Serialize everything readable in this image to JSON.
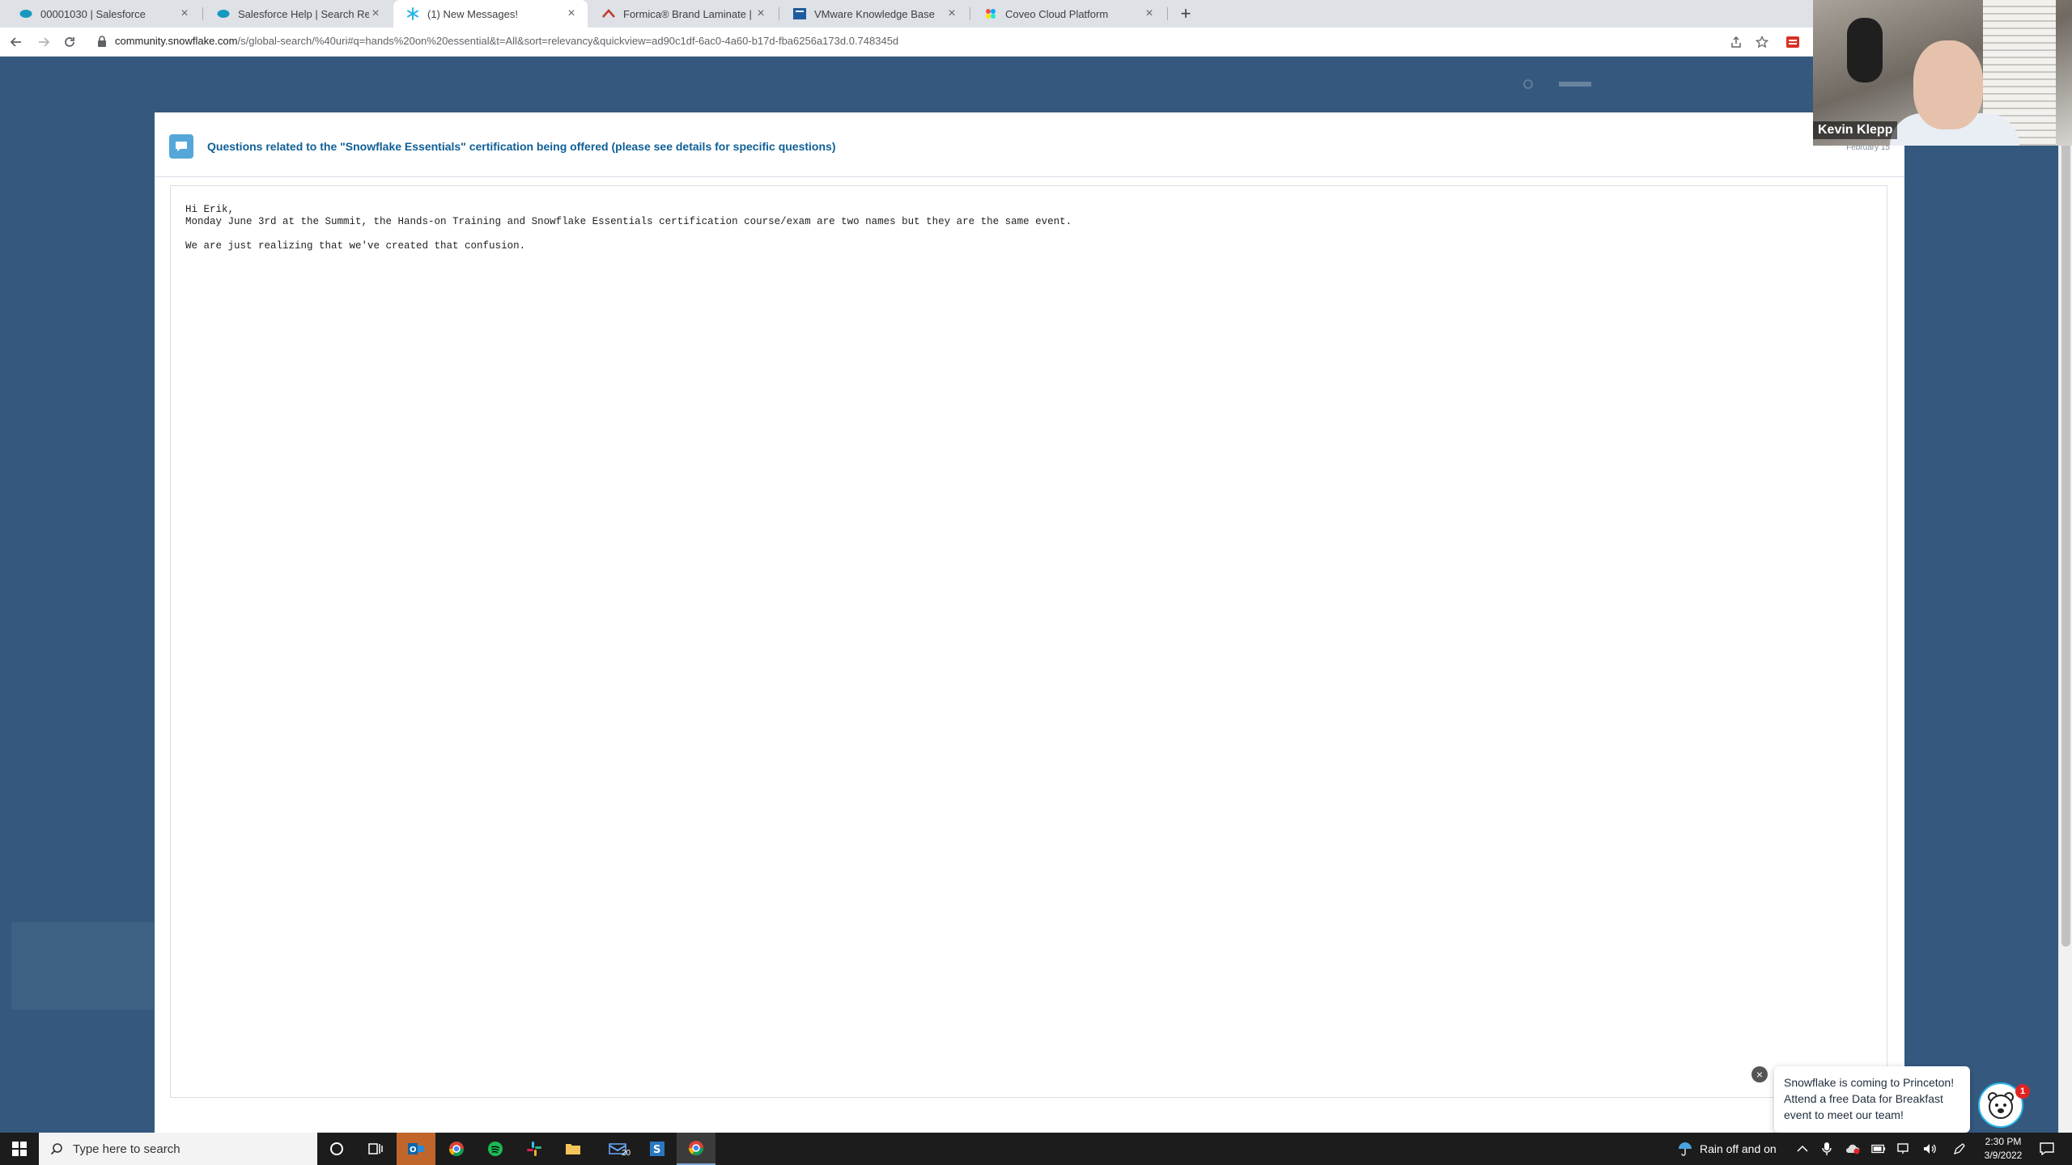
{
  "browser": {
    "tabs": [
      {
        "title": "00001030 | Salesforce",
        "icon": "salesforce-cloud-icon"
      },
      {
        "title": "Salesforce Help | Search Results",
        "icon": "salesforce-cloud-icon"
      },
      {
        "title": "(1) New Messages!",
        "icon": "snowflake-icon"
      },
      {
        "title": "Formica® Brand Laminate | Form",
        "icon": "formica-icon"
      },
      {
        "title": "VMware Knowledge Base",
        "icon": "vmware-icon"
      },
      {
        "title": "Coveo Cloud Platform",
        "icon": "coveo-icon"
      }
    ],
    "active_tab": 2,
    "address": {
      "host": "community.snowflake.com",
      "path": "/s/global-search/%40uri#q=hands%20on%20essential&t=All&sort=relevancy&quickview=ad90c1df-6ac0-4a60-b17d-fba6256a173d.0.748345d"
    }
  },
  "modal": {
    "title": "Questions related to the \"Snowflake Essentials\" certification being offered (please see details for specific questions)",
    "date": "February 15",
    "message": {
      "line1": "Hi Erik,",
      "line2": "Monday June 3rd at the Summit, the Hands-on Training and Snowflake Essentials certification course/exam are two names but they are the same event.",
      "line3": "We are just realizing that we've created that confusion."
    }
  },
  "video": {
    "name": "Kevin Klepp"
  },
  "popup": {
    "text": "Snowflake is coming to Princeton! Attend a free Data for Breakfast event to meet our team!",
    "badge": "1"
  },
  "taskbar": {
    "search_placeholder": "Type here to search",
    "weather": "Rain off and on",
    "time": "2:30 PM",
    "date": "3/9/2022",
    "mail_badge": "20"
  },
  "colors": {
    "page_bg": "#35597e",
    "link_title": "#0f5f95",
    "accent": "#29b5e8"
  }
}
